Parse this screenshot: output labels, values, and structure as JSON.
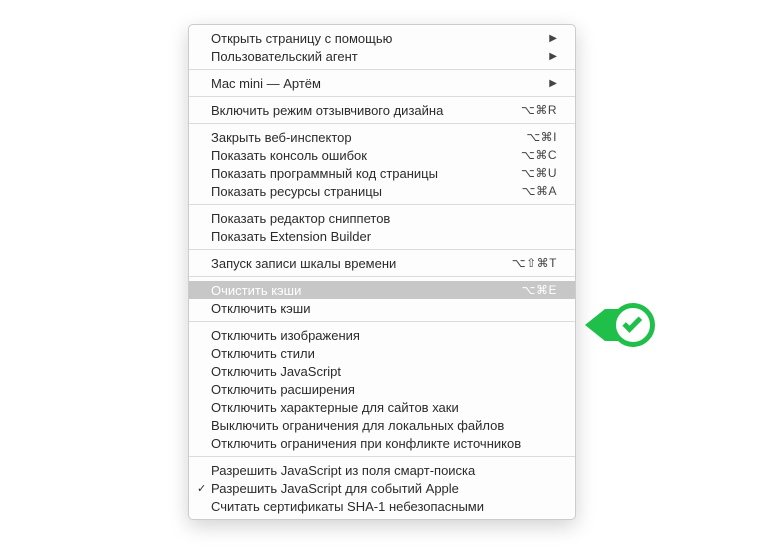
{
  "menu": {
    "groups": [
      [
        {
          "label": "Открыть страницу с помощью",
          "submenu": true
        },
        {
          "label": "Пользовательский агент",
          "submenu": true
        }
      ],
      [
        {
          "label": "Mac mini — Артём",
          "submenu": true
        }
      ],
      [
        {
          "label": "Включить режим отзывчивого дизайна",
          "accel": "⌥⌘R"
        }
      ],
      [
        {
          "label": "Закрыть веб-инспектор",
          "accel": "⌥⌘I"
        },
        {
          "label": "Показать консоль ошибок",
          "accel": "⌥⌘C"
        },
        {
          "label": "Показать программный код страницы",
          "accel": "⌥⌘U"
        },
        {
          "label": "Показать ресурсы страницы",
          "accel": "⌥⌘A"
        }
      ],
      [
        {
          "label": "Показать редактор сниппетов"
        },
        {
          "label": "Показать Extension Builder"
        }
      ],
      [
        {
          "label": "Запуск записи шкалы времени",
          "accel": "⌥⇧⌘T"
        }
      ],
      [
        {
          "label": "Очистить кэши",
          "accel": "⌥⌘E",
          "highlight": true
        },
        {
          "label": "Отключить кэши"
        }
      ],
      [
        {
          "label": "Отключить изображения"
        },
        {
          "label": "Отключить стили"
        },
        {
          "label": "Отключить JavaScript"
        },
        {
          "label": "Отключить расширения"
        },
        {
          "label": "Отключить характерные для сайтов хаки"
        },
        {
          "label": "Выключить ограничения для локальных файлов"
        },
        {
          "label": "Отключить ограничения при конфликте источников"
        }
      ],
      [
        {
          "label": "Разрешить JavaScript из поля смарт-поиска"
        },
        {
          "label": "Разрешить JavaScript для событий Apple",
          "checked": true
        },
        {
          "label": "Считать сертификаты SHA-1 небезопасными"
        }
      ]
    ]
  },
  "badge": {
    "color": "#1fbf4a",
    "icon": "checkmark"
  }
}
